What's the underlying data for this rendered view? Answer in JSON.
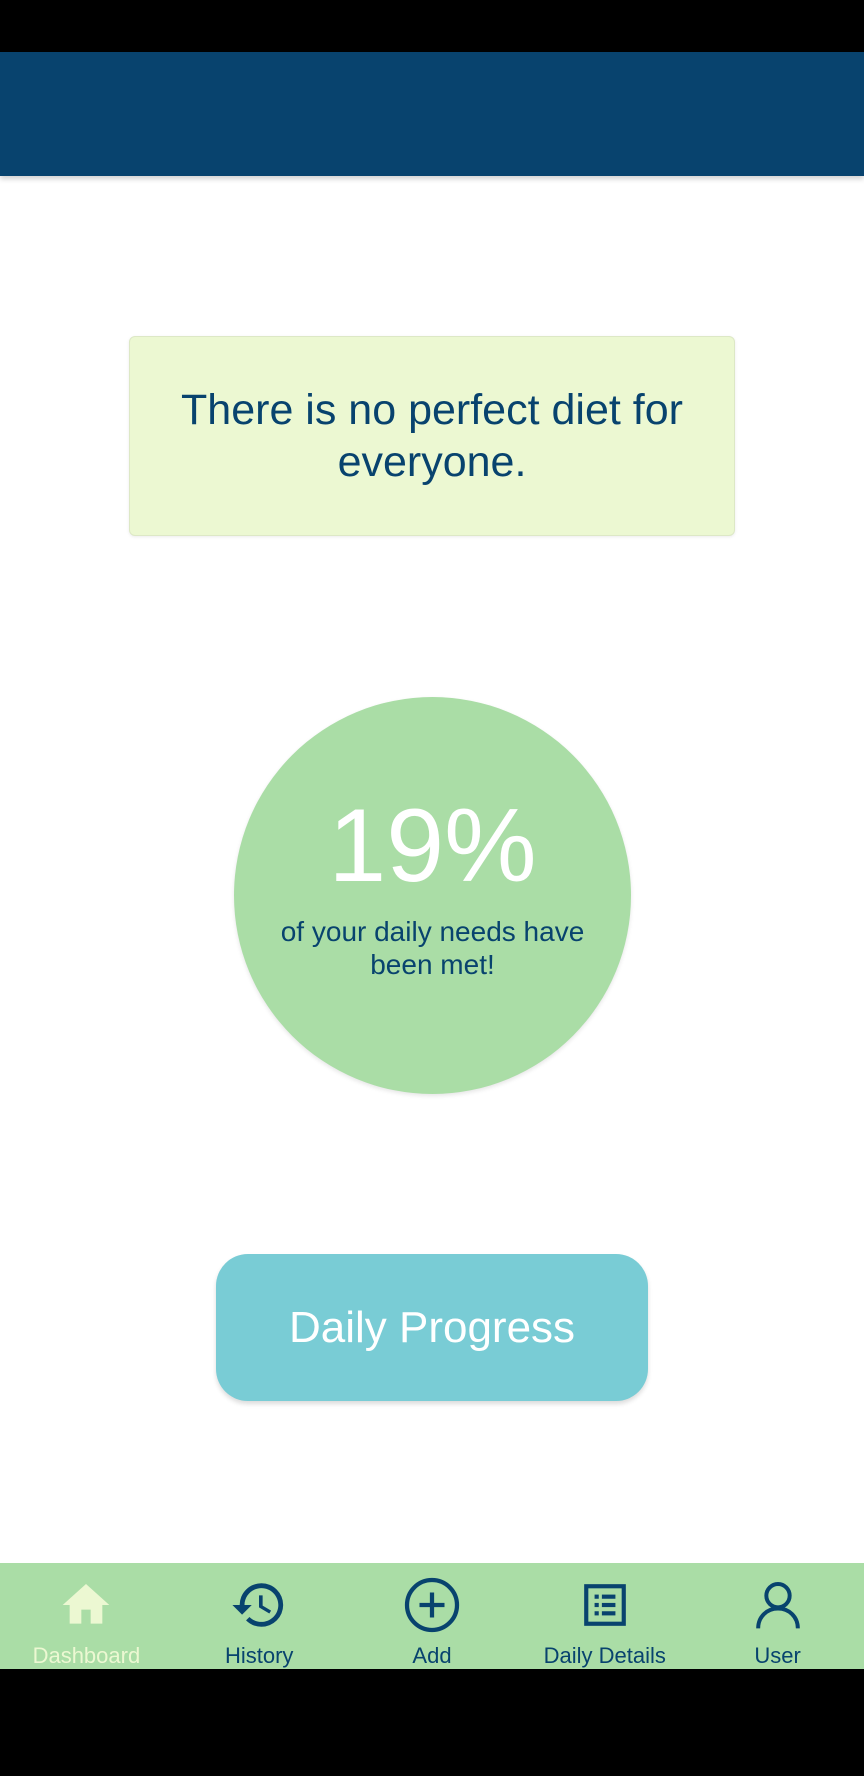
{
  "quote": {
    "text": "There is no perfect diet for everyone."
  },
  "progress": {
    "percent_label": "19%",
    "value_percent": 19,
    "caption": "of your daily needs have been met!"
  },
  "daily_progress_button": {
    "label": "Daily Progress"
  },
  "bottom_nav": {
    "items": [
      {
        "label": "Dashboard",
        "icon": "home-icon",
        "active": true
      },
      {
        "label": "History",
        "icon": "history-icon",
        "active": false
      },
      {
        "label": "Add",
        "icon": "add-circle-icon",
        "active": false
      },
      {
        "label": "Daily Details",
        "icon": "list-icon",
        "active": false
      },
      {
        "label": "User",
        "icon": "user-icon",
        "active": false
      }
    ]
  },
  "colors": {
    "app_bar": "#08436e",
    "quote_card": "#ecf8d2",
    "progress_circle": "#aadda6",
    "button": "#79ccd5",
    "nav_background": "#aadda6",
    "nav_active": "#ecf8d2",
    "text_primary": "#08436e"
  }
}
